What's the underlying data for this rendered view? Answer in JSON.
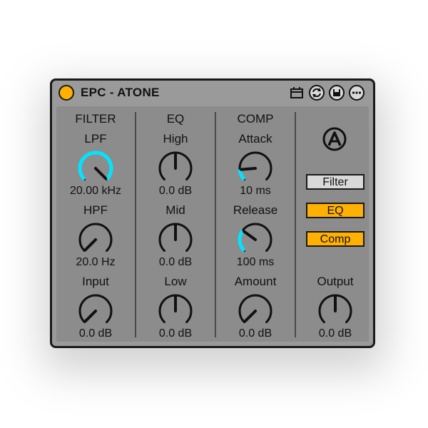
{
  "device": {
    "title": "EPC - ATONE"
  },
  "colors": {
    "accent": "#00e5ff",
    "power": "#ffb000",
    "active_button": "#ffb000",
    "inactive_button": "#d9d9d9"
  },
  "sections": {
    "filter": {
      "header": "FILTER",
      "lpf": {
        "label": "LPF",
        "value": "20.00 kHz"
      },
      "hpf": {
        "label": "HPF",
        "value": "20.0 Hz"
      },
      "input": {
        "label": "Input",
        "value": "0.0 dB"
      }
    },
    "eq": {
      "header": "EQ",
      "high": {
        "label": "High",
        "value": "0.0 dB"
      },
      "mid": {
        "label": "Mid",
        "value": "0.0 dB"
      },
      "low": {
        "label": "Low",
        "value": "0.0 dB"
      }
    },
    "comp": {
      "header": "COMP",
      "attack": {
        "label": "Attack",
        "value": "10 ms"
      },
      "release": {
        "label": "Release",
        "value": "100 ms"
      },
      "amount": {
        "label": "Amount",
        "value": "0.0 dB"
      }
    },
    "output": {
      "label": "Output",
      "value": "0.0 dB"
    }
  },
  "toggles": {
    "filter": "Filter",
    "eq": "EQ",
    "comp": "Comp"
  },
  "toggle_state": {
    "filter": false,
    "eq": true,
    "comp": true
  },
  "knob_levels": {
    "lpf": 1.0,
    "hpf": 0.0,
    "input": 0.0,
    "high": 0.5,
    "mid": 0.5,
    "low": 0.5,
    "attack": 0.15,
    "release": 0.3,
    "amount": 0.0,
    "output": 0.5
  }
}
